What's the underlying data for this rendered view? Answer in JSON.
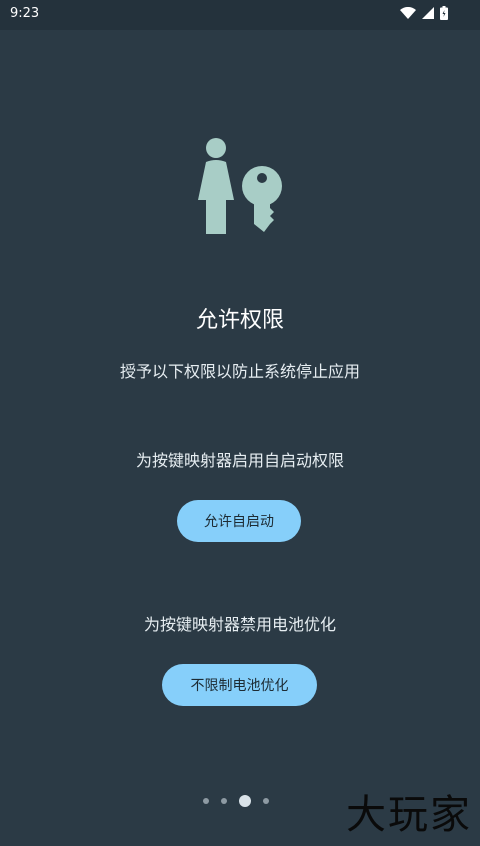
{
  "status_bar": {
    "time": "9:23",
    "icons": [
      "wifi-icon",
      "cellular-signal-icon",
      "battery-icon"
    ]
  },
  "page": {
    "title": "允许权限",
    "subtitle": "授予以下权限以防止系统停止应用",
    "autostart": {
      "description": "为按键映射器启用自启动权限",
      "button_label": "允许自启动"
    },
    "battery": {
      "description": "为按键映射器禁用电池优化",
      "button_label": "不限制电池优化"
    }
  },
  "pager": {
    "total": 4,
    "current_index": 2
  },
  "watermark": "大玩家",
  "colors": {
    "background": "#2b3a45",
    "accent_button": "#86cffa",
    "illustration": "#a8cdc6"
  }
}
